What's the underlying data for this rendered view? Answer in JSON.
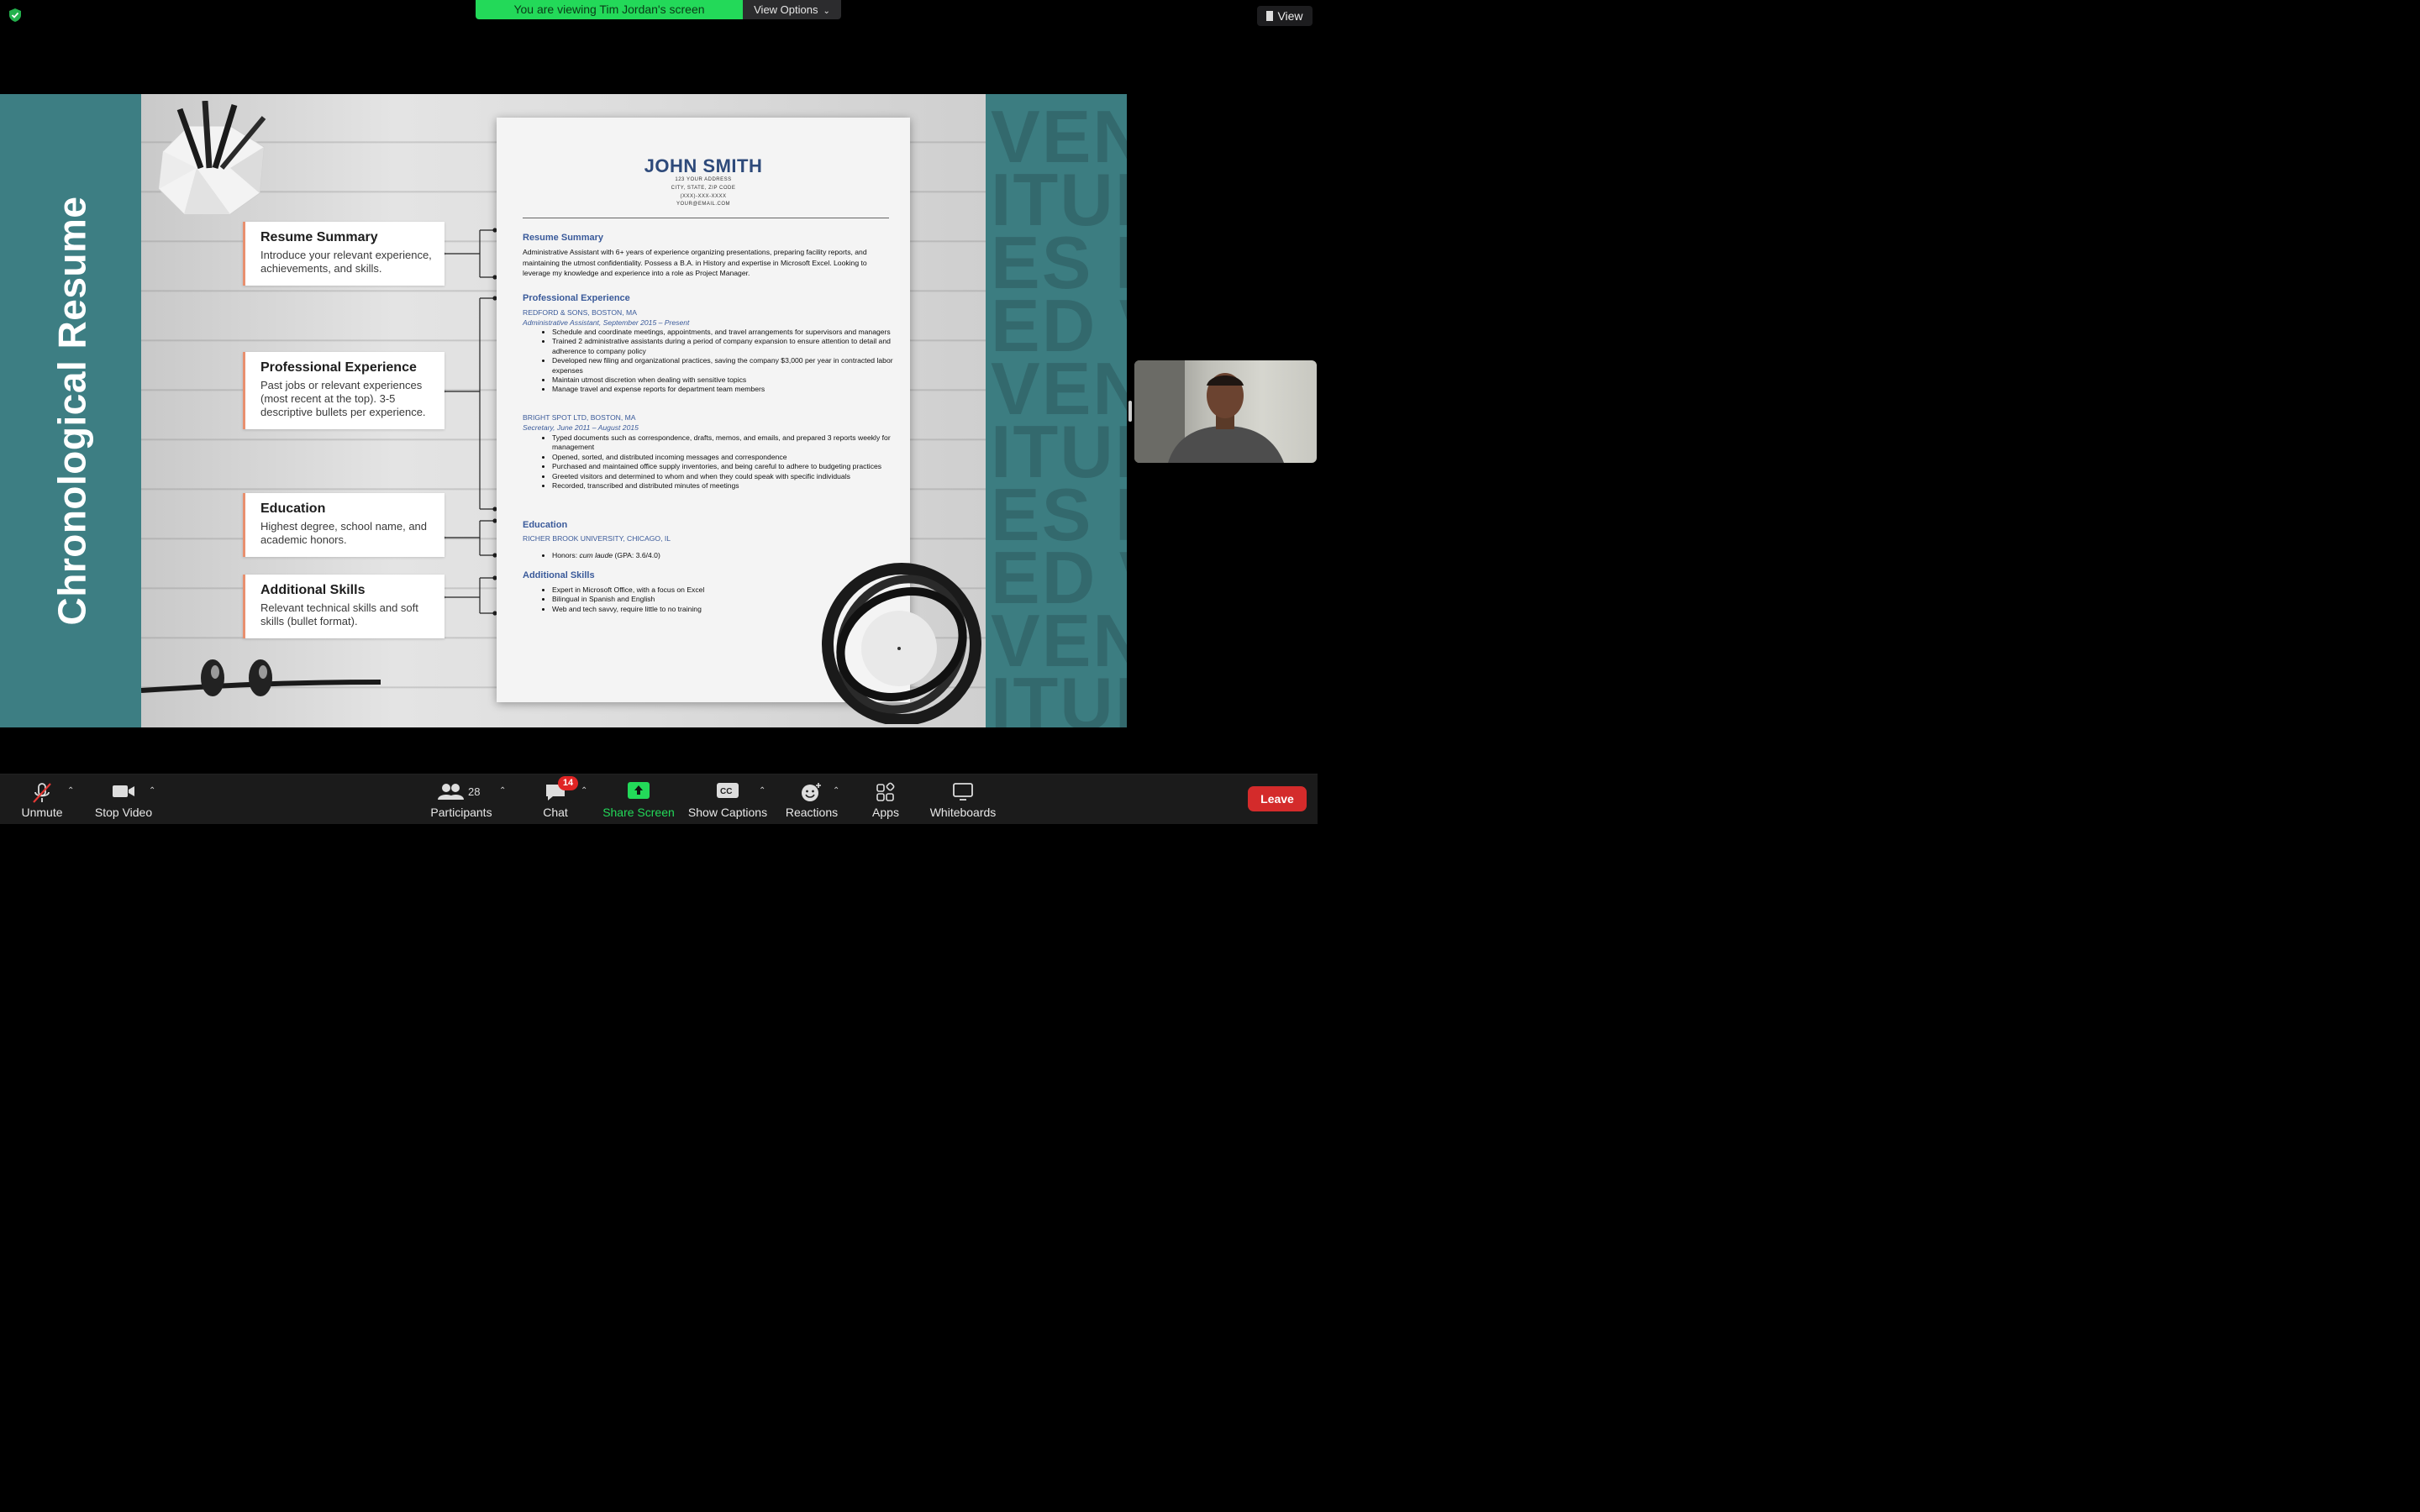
{
  "top_bar": {
    "banner": "You are viewing Tim Jordan's screen",
    "view_options": "View Options",
    "view_label": "View"
  },
  "slide": {
    "vertical_title": "Chronological Resume",
    "background_words": [
      "VEN",
      "ITUI",
      "ES F",
      "ED V",
      "VEN",
      "ITUI",
      "ES F",
      "ED V",
      "VEN",
      "ITUI"
    ],
    "callouts": [
      {
        "title": "Resume Summary",
        "text": "Introduce your relevant experience, achievements, and skills."
      },
      {
        "title": "Professional Experience",
        "text": "Past jobs or relevant experiences (most recent at the top). 3-5 descriptive bullets per experience."
      },
      {
        "title": "Education",
        "text": "Highest degree, school name, and academic honors."
      },
      {
        "title": "Additional Skills",
        "text": "Relevant technical skills and soft skills (bullet format)."
      }
    ],
    "resume": {
      "name": "JOHN SMITH",
      "contact": [
        "123 YOUR ADDRESS",
        "CITY, STATE, ZIP CODE",
        "(XXX)-XXX-XXXX",
        "YOUR@EMAIL.COM"
      ],
      "summary_heading": "Resume Summary",
      "summary_text": "Administrative Assistant with 6+ years of experience organizing presentations, preparing facility reports, and maintaining the utmost confidentiality. Possess a B.A. in History and expertise in Microsoft Excel. Looking to leverage my knowledge and experience into a role as Project Manager.",
      "experience_heading": "Professional Experience",
      "job1_org": "REDFORD & SONS, BOSTON, MA",
      "job1_role": "Administrative Assistant, September 2015 – Present",
      "job1_bullets": [
        "Schedule and coordinate meetings, appointments, and travel arrangements for supervisors and managers",
        "Trained 2 administrative assistants during a period of company expansion to ensure attention to detail and adherence to company policy",
        "Developed new filing and organizational practices, saving the company $3,000 per year in contracted labor expenses",
        "Maintain utmost discretion when dealing with sensitive topics",
        "Manage travel and expense reports for department team members"
      ],
      "job2_org": "BRIGHT SPOT LTD, BOSTON, MA",
      "job2_role": "Secretary, June 2011 – August 2015",
      "job2_bullets": [
        "Typed documents such as correspondence, drafts, memos, and emails, and prepared 3 reports weekly for management",
        "Opened, sorted, and distributed incoming messages and correspondence",
        "Purchased and maintained office supply inventories, and being careful to adhere to budgeting practices",
        "Greeted visitors and determined to whom and when they could speak with specific individuals",
        "Recorded, transcribed and distributed minutes of meetings"
      ],
      "education_heading": "Education",
      "school": "RICHER BROOK UNIVERSITY, CHICAGO, IL",
      "honors_prefix": "Honors: ",
      "honors_italic": "cum laude",
      "honors_suffix": " (GPA: 3.6/4.0)",
      "skills_heading": "Additional Skills",
      "skills": [
        "Expert in Microsoft Office, with a focus on Excel",
        "Bilingual in Spanish and English",
        "Web and tech savvy, require little to no training"
      ]
    }
  },
  "toolbar": {
    "unmute": "Unmute",
    "stop_video": "Stop Video",
    "participants": "Participants",
    "participants_count": "28",
    "chat": "Chat",
    "chat_badge": "14",
    "share_screen": "Share Screen",
    "captions": "Show Captions",
    "captions_icon_text": "CC",
    "reactions": "Reactions",
    "apps": "Apps",
    "whiteboards": "Whiteboards",
    "leave": "Leave"
  },
  "colors": {
    "banner_green": "#23d959",
    "share_green": "#23d959",
    "teal": "#3d7e83",
    "leave_red": "#d42b2b",
    "resume_blue": "#2e4a7a",
    "callout_accent": "#e8906f"
  }
}
